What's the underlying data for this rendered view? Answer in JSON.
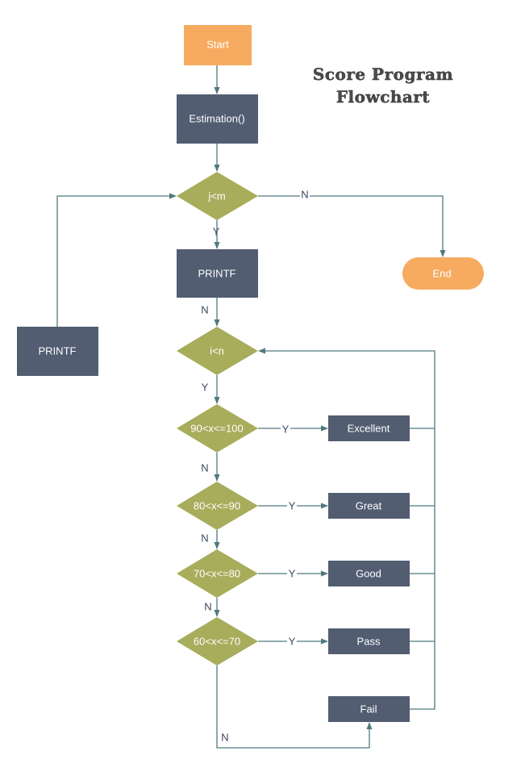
{
  "title": {
    "line1": "Score Program",
    "line2": "Flowchart"
  },
  "colors": {
    "terminal": "#F6AB60",
    "process": "#525D72",
    "decision": "#A7AD5B",
    "connector": "#4F7A7D",
    "label_text": "#3A4660",
    "node_text": "#FFFFFF"
  },
  "nodes": {
    "start": {
      "label": "Start",
      "shape": "rectangle"
    },
    "estimation": {
      "label": "Estimation()",
      "shape": "process"
    },
    "cond_j": {
      "label": "j<m",
      "shape": "decision"
    },
    "printf_main": {
      "label": "PRINTF",
      "shape": "process"
    },
    "printf_side": {
      "label": "PRINTF",
      "shape": "process"
    },
    "end": {
      "label": "End",
      "shape": "terminal"
    },
    "cond_i": {
      "label": "i<n",
      "shape": "decision"
    },
    "cond_90": {
      "label": "90<x<=100",
      "shape": "decision"
    },
    "cond_80": {
      "label": "80<x<=90",
      "shape": "decision"
    },
    "cond_70": {
      "label": "70<x<=80",
      "shape": "decision"
    },
    "cond_60": {
      "label": "60<x<=70",
      "shape": "decision"
    },
    "excellent": {
      "label": "Excellent",
      "shape": "process"
    },
    "great": {
      "label": "Great",
      "shape": "process"
    },
    "good": {
      "label": "Good",
      "shape": "process"
    },
    "pass": {
      "label": "Pass",
      "shape": "process"
    },
    "fail": {
      "label": "Fail",
      "shape": "process"
    }
  },
  "edges": [
    {
      "from": "start",
      "to": "estimation",
      "label": ""
    },
    {
      "from": "estimation",
      "to": "cond_j",
      "label": ""
    },
    {
      "from": "cond_j",
      "to": "printf_main",
      "label": "Y"
    },
    {
      "from": "cond_j",
      "to": "end",
      "label": "N"
    },
    {
      "from": "printf_main",
      "to": "cond_i",
      "label": "N"
    },
    {
      "from": "printf_side",
      "to": "cond_j",
      "label": ""
    },
    {
      "from": "cond_i",
      "to": "cond_90",
      "label": "Y"
    },
    {
      "from": "cond_90",
      "to": "excellent",
      "label": "Y"
    },
    {
      "from": "cond_90",
      "to": "cond_80",
      "label": "N"
    },
    {
      "from": "cond_80",
      "to": "great",
      "label": "Y"
    },
    {
      "from": "cond_80",
      "to": "cond_70",
      "label": "N"
    },
    {
      "from": "cond_70",
      "to": "good",
      "label": "Y"
    },
    {
      "from": "cond_70",
      "to": "cond_60",
      "label": "N"
    },
    {
      "from": "cond_60",
      "to": "pass",
      "label": "Y"
    },
    {
      "from": "cond_60",
      "to": "fail",
      "label": "N"
    },
    {
      "from": "excellent",
      "to": "cond_i",
      "label": ""
    },
    {
      "from": "great",
      "to": "cond_i",
      "label": ""
    },
    {
      "from": "good",
      "to": "cond_i",
      "label": ""
    },
    {
      "from": "pass",
      "to": "cond_i",
      "label": ""
    },
    {
      "from": "fail",
      "to": "cond_i",
      "label": ""
    }
  ],
  "edge_labels": {
    "y": "Y",
    "n": "N"
  }
}
